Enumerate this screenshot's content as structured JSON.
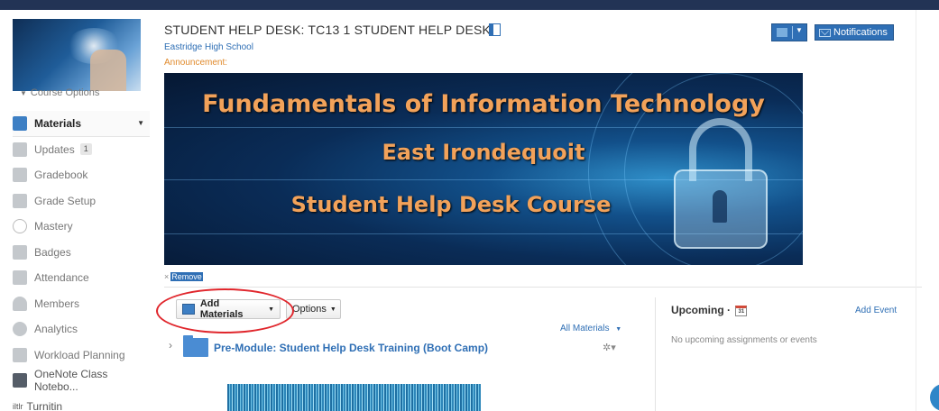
{
  "sidebar": {
    "course_options": "Course Options",
    "items": [
      {
        "label": "Materials",
        "icon": "materials-icon",
        "active": true
      },
      {
        "label": "Updates",
        "icon": "updates-icon",
        "count": "1"
      },
      {
        "label": "Gradebook",
        "icon": "gradebook-icon"
      },
      {
        "label": "Grade Setup",
        "icon": "grade-setup-icon"
      },
      {
        "label": "Mastery",
        "icon": "mastery-icon"
      },
      {
        "label": "Badges",
        "icon": "badges-icon"
      },
      {
        "label": "Attendance",
        "icon": "attendance-icon"
      },
      {
        "label": "Members",
        "icon": "members-icon"
      },
      {
        "label": "Analytics",
        "icon": "analytics-icon"
      },
      {
        "label": "Workload Planning",
        "icon": "workload-planning-icon"
      },
      {
        "label": "OneNote Class Notebo...",
        "icon": "onenote-icon"
      },
      {
        "label": "Turnitin",
        "icon": "turnitin-icon",
        "icon_text": "iltlr"
      }
    ]
  },
  "header": {
    "title": "STUDENT HELP DESK: TC13 1 STUDENT HELP DESK",
    "school": "Eastridge High School",
    "announcement_label": "Announcement:",
    "notifications": "Notifications"
  },
  "banner": {
    "line1": "Fundamentals of Information Technology",
    "line2": "East Irondequoit",
    "line3": "Student Help Desk Course",
    "remove": "Remove"
  },
  "materials": {
    "add_materials": "Add Materials",
    "options": "Options",
    "filter": "All Materials",
    "folders": [
      {
        "name": "Pre-Module: Student Help Desk Training (Boot Camp)"
      }
    ]
  },
  "upcoming": {
    "title": "Upcoming",
    "calendar_day": "31",
    "add_event": "Add Event",
    "empty": "No upcoming assignments or events"
  },
  "colors": {
    "accent": "#2f6fb5",
    "topbar": "#223355",
    "banner_text": "#f2a25a",
    "highlight_circle": "#e0262c"
  }
}
